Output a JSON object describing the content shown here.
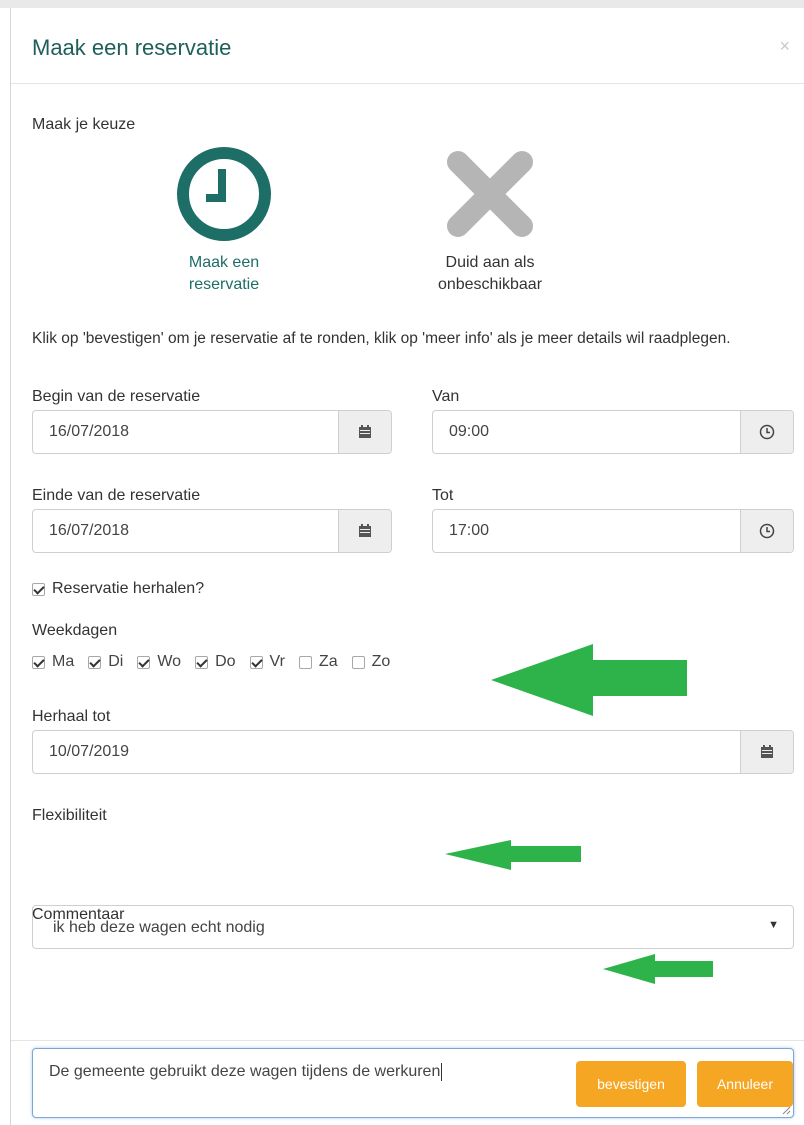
{
  "modal": {
    "title": "Maak een reservatie",
    "close": "×"
  },
  "choices": {
    "label": "Maak je keuze",
    "option1": {
      "line1": "Maak een",
      "line2": "reservatie",
      "icon": "clock-icon"
    },
    "option2": {
      "line1": "Duid aan als",
      "line2": "onbeschikbaar",
      "icon": "x-icon"
    }
  },
  "help_text": "Klik op 'bevestigen' om je reservatie af te ronden, klik op 'meer info' als je meer details wil raadplegen.",
  "begin": {
    "label": "Begin van de reservatie",
    "value": "16/07/2018"
  },
  "van": {
    "label": "Van",
    "value": "09:00"
  },
  "einde": {
    "label": "Einde van de reservatie",
    "value": "16/07/2018"
  },
  "tot": {
    "label": "Tot",
    "value": "17:00"
  },
  "repeat": {
    "label": "Reservatie herhalen?",
    "checked": true
  },
  "weekdays": {
    "label": "Weekdagen",
    "days": [
      {
        "label": "Ma",
        "checked": true
      },
      {
        "label": "Di",
        "checked": true
      },
      {
        "label": "Wo",
        "checked": true
      },
      {
        "label": "Do",
        "checked": true
      },
      {
        "label": "Vr",
        "checked": true
      },
      {
        "label": "Za",
        "checked": false
      },
      {
        "label": "Zo",
        "checked": false
      }
    ]
  },
  "repeat_until": {
    "label": "Herhaal tot",
    "value": "10/07/2019"
  },
  "flex": {
    "label": "Flexibiliteit",
    "value": "ik heb deze wagen echt nodig"
  },
  "comment": {
    "label": "Commentaar",
    "value": "De gemeente gebruikt deze wagen tijdens de werkuren"
  },
  "buttons": {
    "confirm": "bevestigen",
    "cancel": "Annuleer"
  },
  "colors": {
    "accent": "#f5a623",
    "teal": "#1d6e67",
    "arrow": "#2db34a"
  }
}
